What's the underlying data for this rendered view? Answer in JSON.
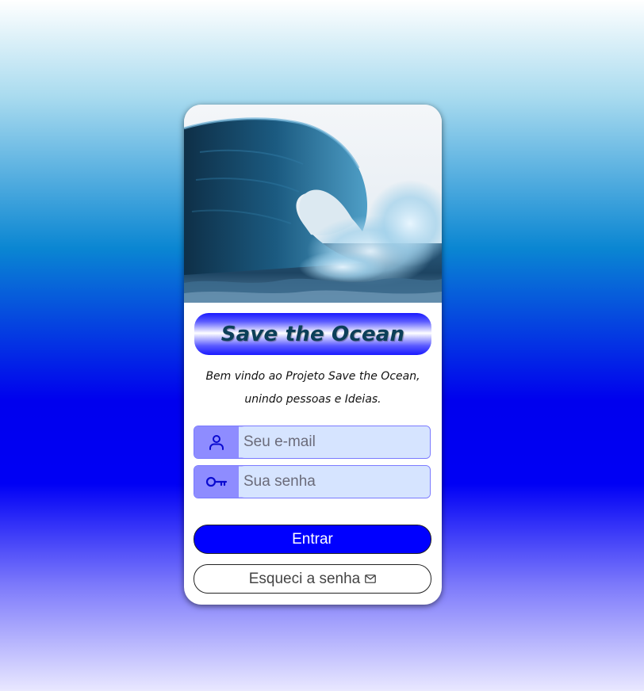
{
  "title": "Save the Ocean",
  "welcome": {
    "line1": "Bem vindo ao Projeto Save the Ocean,",
    "line2": "unindo pessoas e Ideias."
  },
  "email": {
    "placeholder": "Seu e-mail",
    "value": "",
    "icon": "user-icon"
  },
  "password": {
    "placeholder": "Sua senha",
    "value": "",
    "icon": "key-icon"
  },
  "buttons": {
    "login_label": "Entrar",
    "forgot_label": "Esqueci a senha",
    "forgot_icon": "mail-icon"
  },
  "hero": {
    "subject": "ocean-wave-photo"
  },
  "colors": {
    "primary": "#0000ff",
    "field_bg": "#d6e4ff",
    "icon_box": "#8e8cff",
    "title_text": "#0c3f59"
  }
}
